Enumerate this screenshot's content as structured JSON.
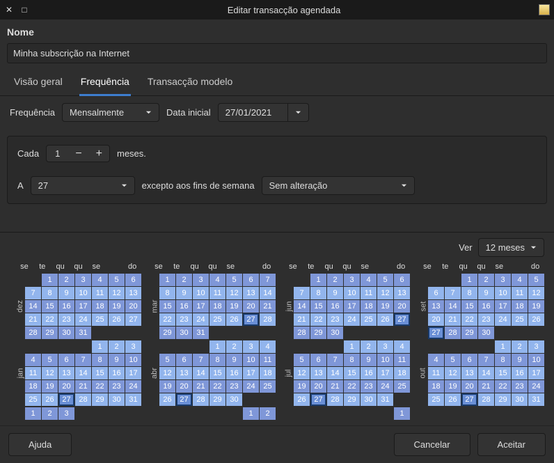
{
  "titlebar": {
    "title": "Editar transacção agendada"
  },
  "labels": {
    "nome": "Nome",
    "freq_label": "Frequência",
    "data_inicial": "Data inicial",
    "cada": "Cada",
    "meses": "meses.",
    "a": "A",
    "excepto": "excepto aos fins de semana",
    "ver": "Ver"
  },
  "fields": {
    "nome_value": "Minha subscrição na Internet",
    "freq_select": "Mensalmente",
    "data_value": "27/01/2021",
    "cada_value": "1",
    "dia_value": "27",
    "weekend_rule": "Sem alteração",
    "view_range": "12 meses"
  },
  "tabs": {
    "t0": "Visão geral",
    "t1": "Frequência",
    "t2": "Transacção modelo"
  },
  "buttons": {
    "ajuda": "Ajuda",
    "cancelar": "Cancelar",
    "aceitar": "Aceitar"
  },
  "weekdays": [
    "se",
    "te",
    "qu",
    "qu",
    "se",
    "",
    "do"
  ],
  "months": {
    "col0": [
      "dez",
      "jan"
    ],
    "col1": [
      "mar",
      "abr"
    ],
    "col2": [
      "jun",
      "jul"
    ],
    "col3": [
      "set",
      "out"
    ]
  },
  "calendars": [
    [
      {
        "lead": 1,
        "days": 31,
        "alt_start": 1,
        "hl": []
      },
      {
        "lead": 4,
        "days": 31,
        "alt_start": 0,
        "hl": [
          27
        ]
      },
      {
        "lead": 0,
        "days": 3,
        "alt_start": 1,
        "hl": []
      }
    ],
    [
      {
        "lead": 0,
        "days": 31,
        "alt_start": 1,
        "hl": [
          27
        ]
      },
      {
        "lead": 3,
        "days": 30,
        "alt_start": 0,
        "hl": [
          27
        ]
      },
      {
        "lead": 5,
        "days": 2,
        "alt_start": 1,
        "hl": []
      }
    ],
    [
      {
        "lead": 1,
        "days": 30,
        "alt_start": 1,
        "hl": [
          27
        ]
      },
      {
        "lead": 3,
        "days": 31,
        "alt_start": 0,
        "hl": [
          27
        ]
      },
      {
        "lead": 6,
        "days": 1,
        "alt_start": 1,
        "hl": []
      }
    ],
    [
      {
        "lead": 2,
        "days": 30,
        "alt_start": 1,
        "hl": [
          27
        ]
      },
      {
        "lead": 4,
        "days": 31,
        "alt_start": 0,
        "hl": [
          27
        ]
      },
      {
        "lead": 0,
        "days": 0,
        "alt_start": 1,
        "hl": []
      }
    ]
  ]
}
